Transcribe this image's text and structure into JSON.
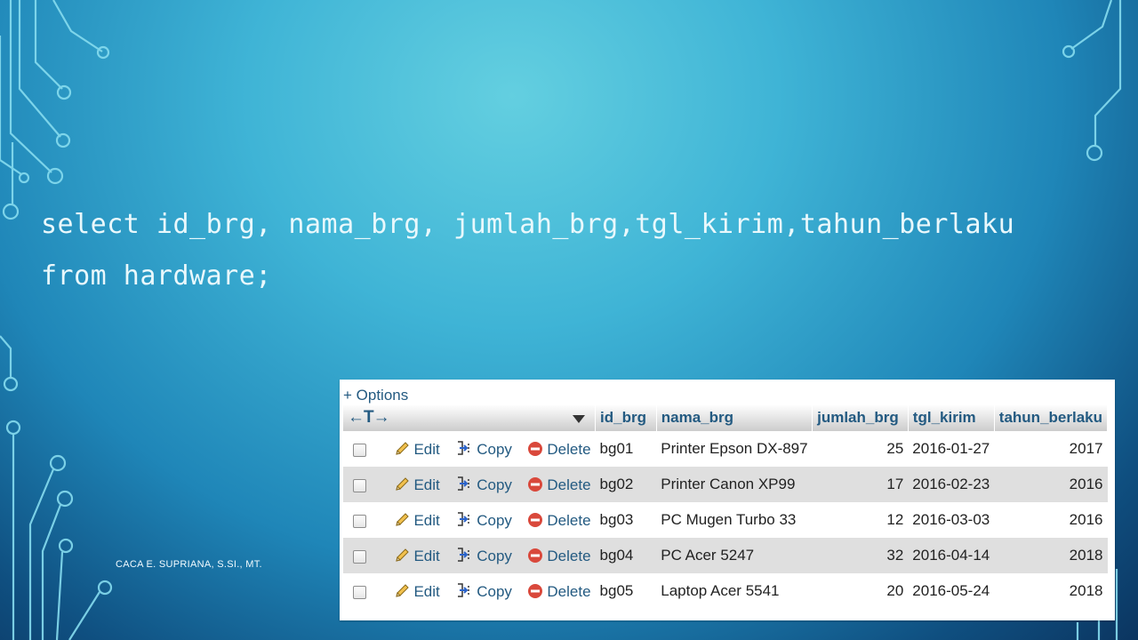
{
  "slide": {
    "sql_line1": "select id_brg, nama_brg, jumlah_brg,tgl_kirim,tahun_berlaku",
    "sql_line2": "from hardware;",
    "footer": "CACA E. SUPRIANA, S.SI., MT."
  },
  "result_panel": {
    "options_label": "+ Options",
    "sort_arrows": "←T→",
    "columns": [
      "id_brg",
      "nama_brg",
      "jumlah_brg",
      "tgl_kirim",
      "tahun_berlaku"
    ],
    "actions": {
      "edit": "Edit",
      "copy": "Copy",
      "delete": "Delete"
    },
    "rows": [
      {
        "id_brg": "bg01",
        "nama_brg": "Printer Epson DX-897",
        "jumlah_brg": "25",
        "tgl_kirim": "2016-01-27",
        "tahun_berlaku": "2017"
      },
      {
        "id_brg": "bg02",
        "nama_brg": "Printer Canon XP99",
        "jumlah_brg": "17",
        "tgl_kirim": "2016-02-23",
        "tahun_berlaku": "2016"
      },
      {
        "id_brg": "bg03",
        "nama_brg": "PC Mugen Turbo 33",
        "jumlah_brg": "12",
        "tgl_kirim": "2016-03-03",
        "tahun_berlaku": "2016"
      },
      {
        "id_brg": "bg04",
        "nama_brg": "PC Acer 5247",
        "jumlah_brg": "32",
        "tgl_kirim": "2016-04-14",
        "tahun_berlaku": "2018"
      },
      {
        "id_brg": "bg05",
        "nama_brg": "Laptop Acer 5541",
        "jumlah_brg": "20",
        "tgl_kirim": "2016-05-24",
        "tahun_berlaku": "2018"
      }
    ]
  },
  "colors": {
    "link_blue": "#235a81",
    "row_alt": "#dfdfdf",
    "delete_red": "#d9483b",
    "circuit_line": "#8fe3f2"
  }
}
